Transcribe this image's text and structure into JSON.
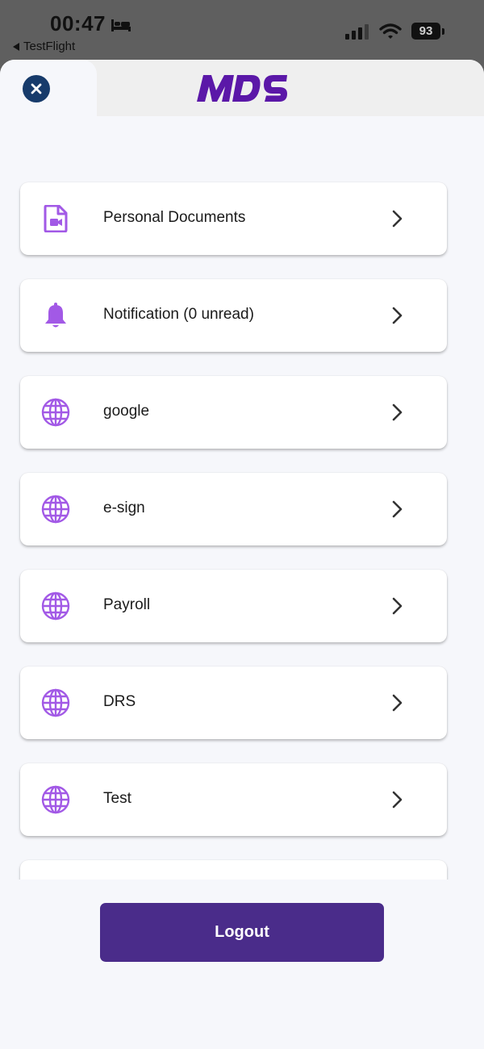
{
  "status_bar": {
    "time": "00:47",
    "back_app": "TestFlight",
    "battery": "93"
  },
  "header": {
    "logo_text": "MDS"
  },
  "colors": {
    "accent": "#a259e6",
    "logout_bg": "#4a2c8a",
    "close_bg": "#173b6b",
    "logo": "#5b18a8"
  },
  "menu": {
    "items": [
      {
        "label": "Personal Documents",
        "icon": "document-video-icon"
      },
      {
        "label": "Notification (0 unread)",
        "icon": "bell-icon"
      },
      {
        "label": "google",
        "icon": "globe-icon"
      },
      {
        "label": "e-sign",
        "icon": "globe-icon"
      },
      {
        "label": "Payroll",
        "icon": "globe-icon"
      },
      {
        "label": "DRS",
        "icon": "globe-icon"
      },
      {
        "label": "Test",
        "icon": "globe-icon"
      },
      {
        "label": "",
        "icon": ""
      }
    ]
  },
  "footer": {
    "logout_label": "Logout"
  }
}
